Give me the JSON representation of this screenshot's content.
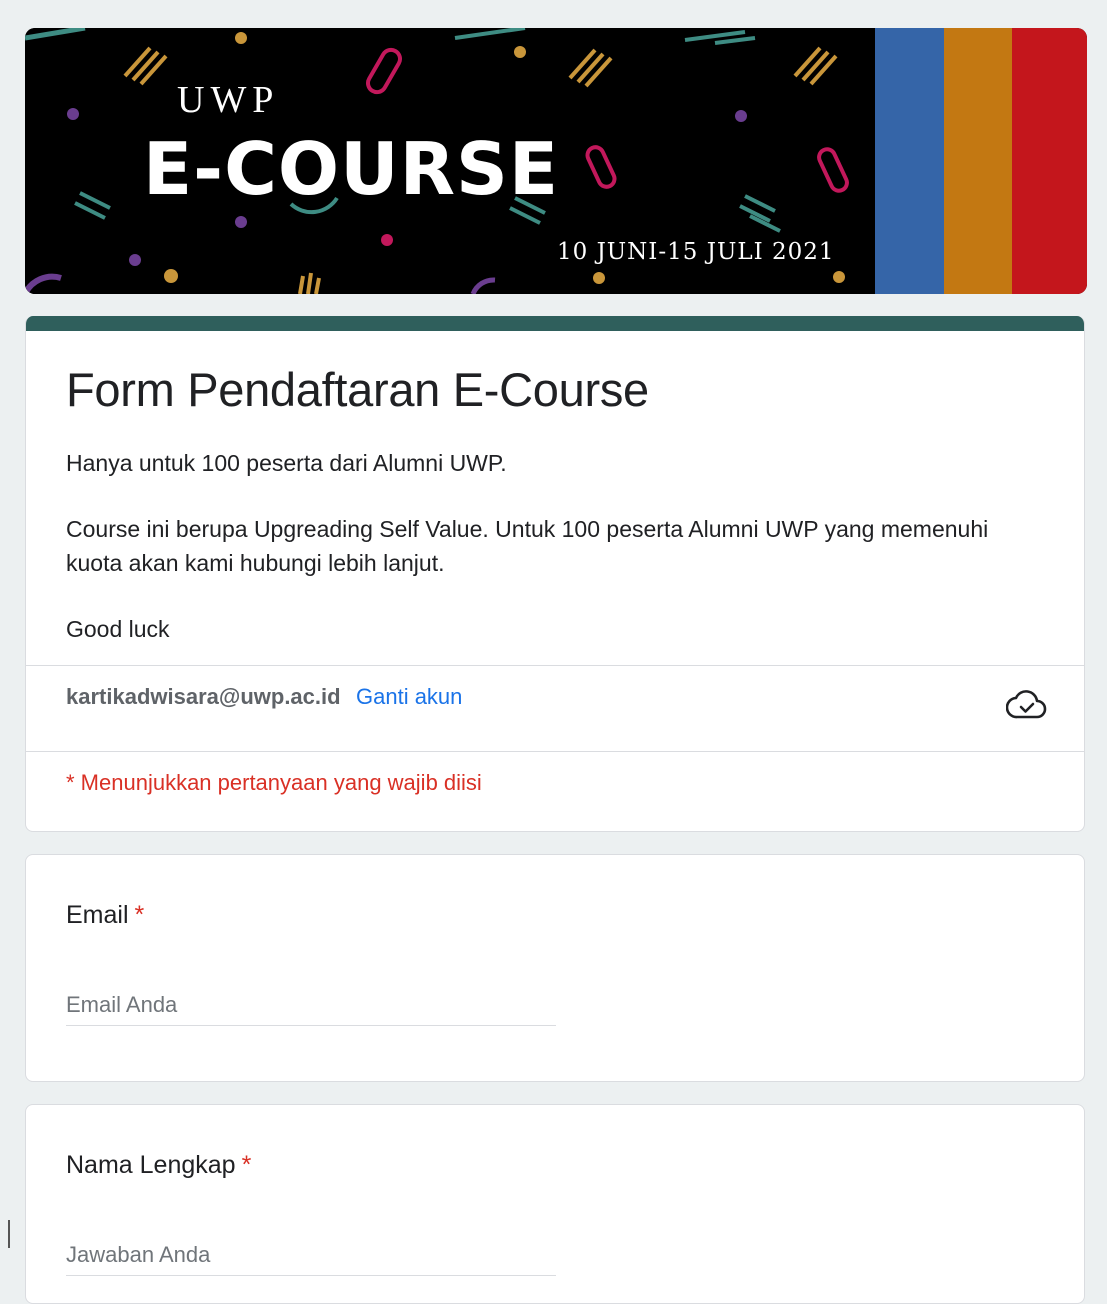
{
  "banner": {
    "brand_top": "UWP",
    "brand_main": "E-COURSE",
    "date_range": "10 JUNI-15 JULI 2021",
    "colors": {
      "background": "#000000",
      "stripe_blue": "#3565a8",
      "stripe_orange": "#c37812",
      "stripe_red": "#c4161c"
    }
  },
  "form": {
    "title": "Form Pendaftaran E-Course",
    "description": [
      "Hanya untuk 100 peserta dari Alumni UWP.",
      "Course ini berupa Upgreading Self Value. Untuk 100 peserta Alumni UWP yang memenuhi kuota akan kami hubungi lebih lanjut.",
      "Good luck"
    ],
    "accent_color": "#2f5f5c"
  },
  "account": {
    "email": "kartikadwisara@uwp.ac.id",
    "switch_label": "Ganti akun",
    "status_icon": "cloud-check-icon"
  },
  "required_note": "* Menunjukkan pertanyaan yang wajib diisi",
  "questions": [
    {
      "title": "Email",
      "required_mark": "*",
      "placeholder": "Email Anda"
    },
    {
      "title": "Nama Lengkap",
      "required_mark": "*",
      "placeholder": "Jawaban Anda"
    }
  ]
}
